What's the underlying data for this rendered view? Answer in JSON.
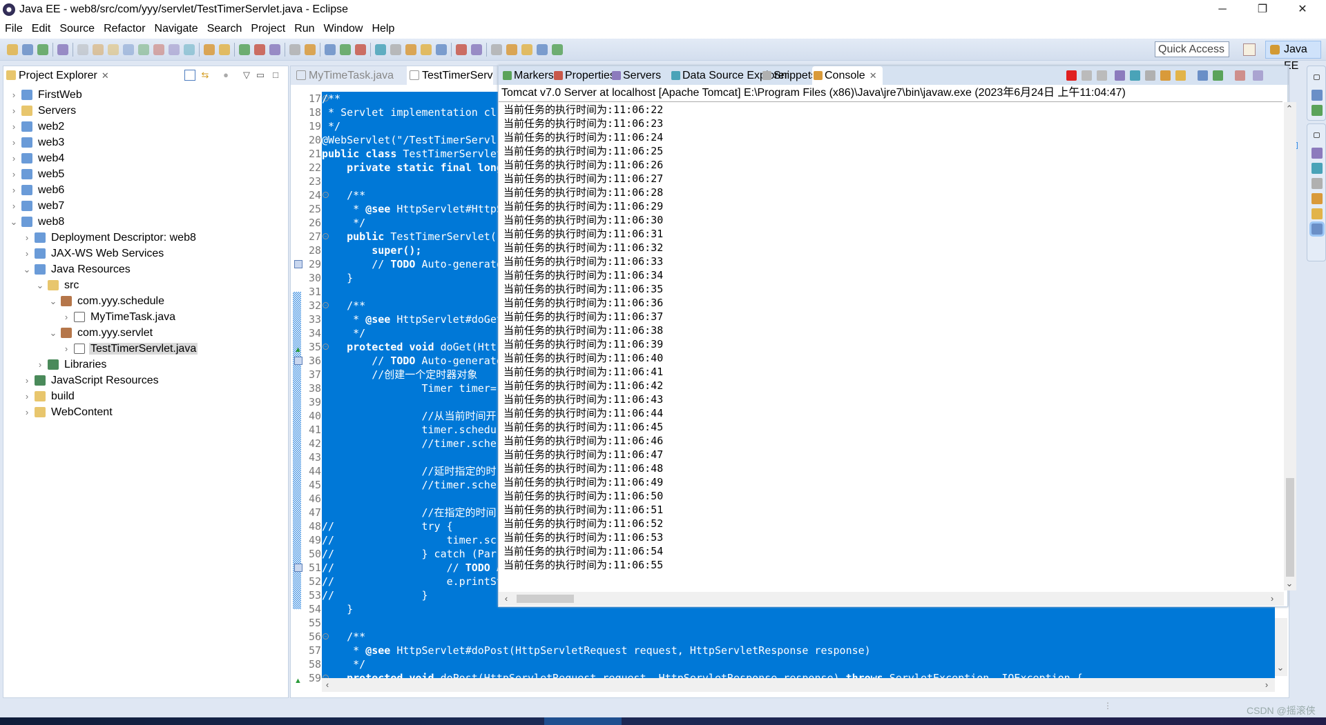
{
  "window": {
    "title": "Java EE - web8/src/com/yyy/servlet/TestTimerServlet.java - Eclipse",
    "minimize": "─",
    "maximize": "❐",
    "close": "✕"
  },
  "menu": [
    "File",
    "Edit",
    "Source",
    "Refactor",
    "Navigate",
    "Search",
    "Project",
    "Run",
    "Window",
    "Help"
  ],
  "toolbar": {
    "icons": [
      "new-icon",
      "save-icon",
      "save-all-icon",
      "sep",
      "console-icon",
      "sep",
      "skip-breakpoints-icon",
      "resume-icon",
      "suspend-icon",
      "terminate-icon",
      "disconnect-icon",
      "step-into-icon",
      "step-over-icon",
      "step-return-icon",
      "sep",
      "use-step-filters-icon",
      "drop-to-frame-icon",
      "sep",
      "debug-icon",
      "run-icon",
      "run-server-icon",
      "sep",
      "new-web-service-icon",
      "new-class-icon",
      "sep",
      "open-type-icon",
      "open-task-icon",
      "search-icon",
      "sep",
      "toggle-mark-icon",
      "annotations-icon",
      "show-whitespace-icon",
      "block-select-icon",
      "paragraph-icon",
      "sep",
      "globe-icon",
      "external-tools-icon",
      "sep",
      "next-annotation-icon",
      "prev-annotation-icon",
      "last-edit-icon",
      "back-icon",
      "forward-icon"
    ],
    "quick_access": "Quick Access",
    "perspective": "Java EE"
  },
  "explorer": {
    "title": "Project Explorer",
    "tree": [
      {
        "label": "FirstWeb",
        "level": 0,
        "state": "collapsed",
        "icon": "web-project-icon"
      },
      {
        "label": "Servers",
        "level": 0,
        "state": "collapsed",
        "icon": "folder-icon"
      },
      {
        "label": "web2",
        "level": 0,
        "state": "collapsed",
        "icon": "web-project-icon"
      },
      {
        "label": "web3",
        "level": 0,
        "state": "collapsed",
        "icon": "web-project-warning-icon"
      },
      {
        "label": "web4",
        "level": 0,
        "state": "collapsed",
        "icon": "web-project-icon"
      },
      {
        "label": "web5",
        "level": 0,
        "state": "collapsed",
        "icon": "web-project-icon"
      },
      {
        "label": "web6",
        "level": 0,
        "state": "collapsed",
        "icon": "web-project-warning-icon"
      },
      {
        "label": "web7",
        "level": 0,
        "state": "collapsed",
        "icon": "web-project-warning-icon"
      },
      {
        "label": "web8",
        "level": 0,
        "state": "expanded",
        "icon": "web-project-warning-icon"
      },
      {
        "label": "Deployment Descriptor: web8",
        "level": 1,
        "state": "collapsed",
        "icon": "deployment-descriptor-icon"
      },
      {
        "label": "JAX-WS Web Services",
        "level": 1,
        "state": "collapsed",
        "icon": "web-services-icon"
      },
      {
        "label": "Java Resources",
        "level": 1,
        "state": "expanded",
        "icon": "java-resources-icon"
      },
      {
        "label": "src",
        "level": 2,
        "state": "expanded",
        "icon": "source-folder-icon"
      },
      {
        "label": "com.yyy.schedule",
        "level": 3,
        "state": "expanded",
        "icon": "package-icon"
      },
      {
        "label": "MyTimeTask.java",
        "level": 4,
        "state": "collapsed",
        "icon": "java-file-icon"
      },
      {
        "label": "com.yyy.servlet",
        "level": 3,
        "state": "expanded",
        "icon": "package-warning-icon"
      },
      {
        "label": "TestTimerServlet.java",
        "level": 4,
        "state": "collapsed",
        "icon": "java-file-warning-icon",
        "selected": true
      },
      {
        "label": "Libraries",
        "level": 2,
        "state": "collapsed",
        "icon": "libraries-icon"
      },
      {
        "label": "JavaScript Resources",
        "level": 1,
        "state": "collapsed",
        "icon": "libraries-icon"
      },
      {
        "label": "build",
        "level": 1,
        "state": "collapsed",
        "icon": "folder-icon"
      },
      {
        "label": "WebContent",
        "level": 1,
        "state": "collapsed",
        "icon": "folder-icon"
      }
    ]
  },
  "editor": {
    "tabs": [
      {
        "label": "MyTimeTask.java",
        "active": false
      },
      {
        "label": "TestTimerServ",
        "active": true
      }
    ],
    "first_line": 17,
    "lines": [
      "/**",
      " * Servlet implementation cl",
      " */",
      "@WebServlet(\"/TestTimerServl",
      "public class TestTimerServlet",
      "    private static final long",
      "",
      "    /**",
      "     * @see HttpServlet#HttpS",
      "     */",
      "    public TestTimerServlet(",
      "        super();",
      "        // TODO Auto-generate",
      "    }",
      "",
      "    /**",
      "     * @see HttpServlet#doGet",
      "     */",
      "    protected void doGet(Htt",
      "        // TODO Auto-generate",
      "        //创建一个定时器对象",
      "                Timer timer=",
      "",
      "                //从当前时间开",
      "                timer.schedu",
      "                //timer.sche",
      "",
      "                //延时指定的时",
      "                //timer.sche",
      "",
      "                //在指定的时间",
      "//              try {",
      "//                  timer.sc",
      "//              } catch (Par",
      "//                  // TODO A",
      "//                  e.printSt",
      "//              }",
      "    }",
      "",
      "    /**",
      "     * @see HttpServlet#doPost(HttpServletRequest request, HttpServletResponse response)",
      "     */",
      "    protected void doPost(HttpServletRequest request, HttpServletResponse response) throws ServletException, IOException {"
    ],
    "fold_lines": [
      17,
      24,
      27,
      32,
      35,
      56,
      59
    ],
    "task_markers": [
      29,
      36,
      51
    ],
    "override_markers": [
      35,
      59
    ]
  },
  "bottom_views": {
    "tabs": [
      {
        "label": "Markers",
        "icon": "markers-icon"
      },
      {
        "label": "Properties",
        "icon": "properties-icon"
      },
      {
        "label": "Servers",
        "icon": "servers-icon"
      },
      {
        "label": "Data Source Explorer",
        "icon": "data-source-icon"
      },
      {
        "label": "Snippets",
        "icon": "snippets-icon"
      },
      {
        "label": "Console",
        "icon": "console-icon",
        "active": true
      }
    ],
    "console_tools": [
      "terminate-icon",
      "remove-launch-icon",
      "remove-all-icon",
      "clear-console-icon",
      "scroll-lock-icon",
      "word-wrap-icon",
      "show-on-stdout-icon",
      "show-on-stderr-icon",
      "pin-console-icon",
      "display-console-icon",
      "open-console-icon",
      "minimize-icon"
    ],
    "console_header": "Tomcat v7.0 Server at localhost [Apache Tomcat] E:\\Program Files (x86)\\Java\\jre7\\bin\\javaw.exe (2023年6月24日 上午11:04:47)",
    "console_lines": [
      "当前任务的执行时间为:11:06:22",
      "当前任务的执行时间为:11:06:23",
      "当前任务的执行时间为:11:06:24",
      "当前任务的执行时间为:11:06:25",
      "当前任务的执行时间为:11:06:26",
      "当前任务的执行时间为:11:06:27",
      "当前任务的执行时间为:11:06:28",
      "当前任务的执行时间为:11:06:29",
      "当前任务的执行时间为:11:06:30",
      "当前任务的执行时间为:11:06:31",
      "当前任务的执行时间为:11:06:32",
      "当前任务的执行时间为:11:06:33",
      "当前任务的执行时间为:11:06:34",
      "当前任务的执行时间为:11:06:35",
      "当前任务的执行时间为:11:06:36",
      "当前任务的执行时间为:11:06:37",
      "当前任务的执行时间为:11:06:38",
      "当前任务的执行时间为:11:06:39",
      "当前任务的执行时间为:11:06:40",
      "当前任务的执行时间为:11:06:41",
      "当前任务的执行时间为:11:06:42",
      "当前任务的执行时间为:11:06:43",
      "当前任务的执行时间为:11:06:44",
      "当前任务的执行时间为:11:06:45",
      "当前任务的执行时间为:11:06:46",
      "当前任务的执行时间为:11:06:47",
      "当前任务的执行时间为:11:06:48",
      "当前任务的执行时间为:11:06:49",
      "当前任务的执行时间为:11:06:50",
      "当前任务的执行时间为:11:06:51",
      "当前任务的执行时间为:11:06:52",
      "当前任务的执行时间为:11:06:53",
      "当前任务的执行时间为:11:06:54",
      "当前任务的执行时间为:11:06:55"
    ]
  },
  "trim_icons": [
    "restore-icon",
    "outline-icon",
    "task-list-icon",
    "restore-icon",
    "markers-icon",
    "properties-icon",
    "servers-icon",
    "data-source-icon",
    "snippets-icon",
    "console-icon"
  ],
  "status": {
    "watermark": "CSDN @摇滚侠"
  },
  "colors": {
    "selection": "#0078d7",
    "tab_bar": "#d6e2f1",
    "background": "#dfe7f3"
  }
}
